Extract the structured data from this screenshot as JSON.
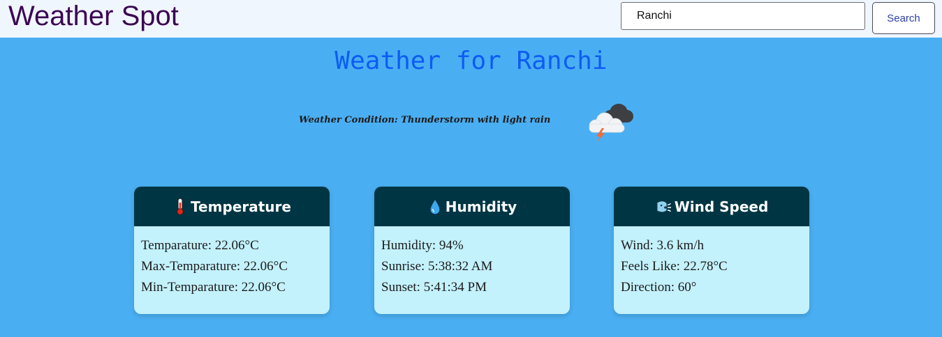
{
  "header": {
    "brand": "Weather Spot",
    "search_value": "Ranchi",
    "search_button": "Search"
  },
  "main": {
    "title": "Weather for Ranchi",
    "condition": "Weather Condition: Thunderstorm with light rain",
    "condition_icon": "thunderstorm-cloud-icon"
  },
  "cards": [
    {
      "title": "Temperature",
      "icon": "thermometer-icon",
      "lines": [
        "Temparature: 22.06°C",
        "Max-Temparature: 22.06°C",
        "Min-Temparature: 22.06°C"
      ]
    },
    {
      "title": "Humidity",
      "icon": "droplet-icon",
      "lines": [
        "Humidity: 94%",
        "Sunrise: 5:38:32 AM",
        "Sunset: 5:41:34 PM"
      ]
    },
    {
      "title": "Wind Speed",
      "icon": "wind-face-icon",
      "lines": [
        "Wind: 3.6 km/h",
        "Feels Like: 22.78°C",
        "Direction: 60°"
      ]
    }
  ],
  "colors": {
    "page_bg": "#4aaff2",
    "navbar_bg": "#f0f6fe",
    "brand": "#3b0552",
    "title": "#0d5cf5",
    "card_header": "#003644",
    "card_body": "#c3f1fc"
  }
}
